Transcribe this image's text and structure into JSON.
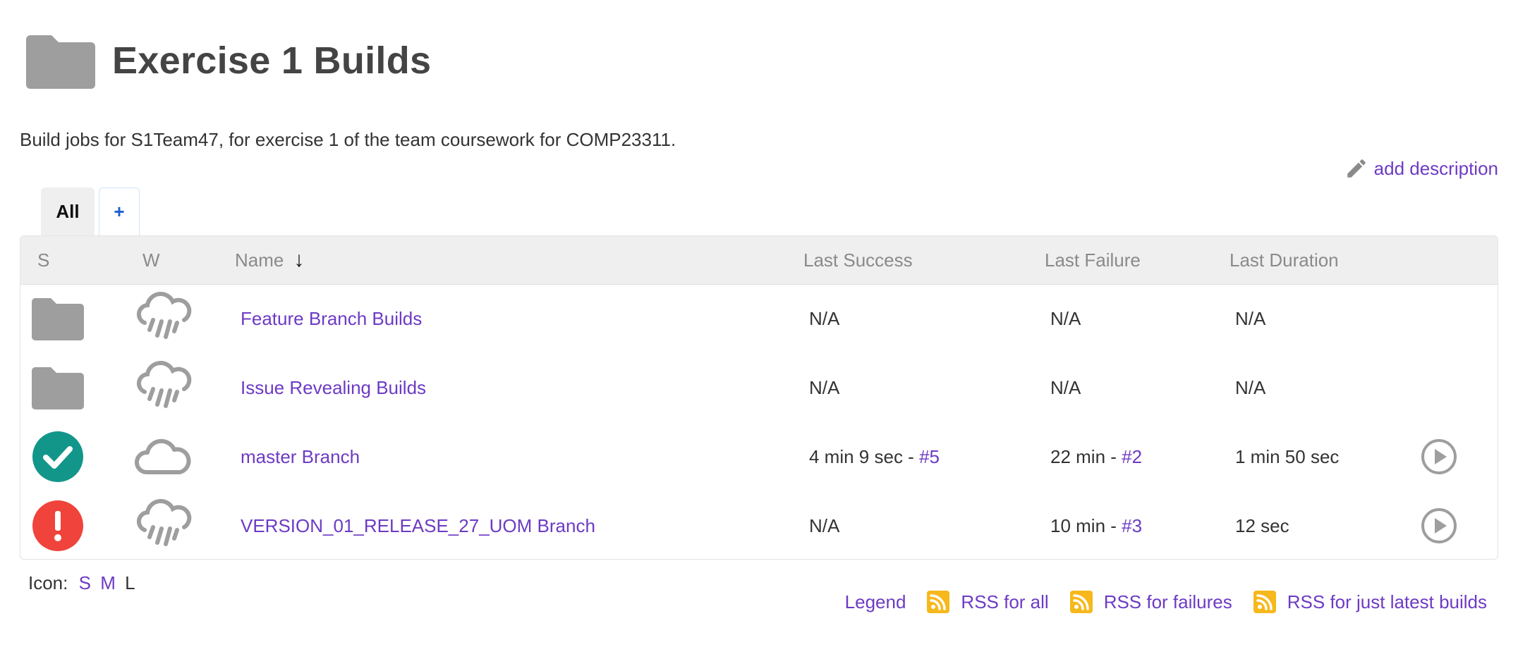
{
  "header": {
    "title": "Exercise 1 Builds"
  },
  "description": "Build jobs for S1Team47, for exercise 1 of the team coursework for COMP23311.",
  "add_description": "add description",
  "tabs": {
    "all": "All",
    "add": "+"
  },
  "table": {
    "headers": {
      "s": "S",
      "w": "W",
      "name": "Name",
      "sort_arrow": "↓",
      "last_success": "Last Success",
      "last_failure": "Last Failure",
      "last_duration": "Last Duration"
    },
    "rows": [
      {
        "status_icon": "folder-icon",
        "weather_icon": "rain-cloud-icon",
        "name": "Feature Branch Builds",
        "last_success": "N/A",
        "last_success_link": "",
        "last_failure": "N/A",
        "last_failure_link": "",
        "last_duration": "N/A",
        "action": ""
      },
      {
        "status_icon": "folder-icon",
        "weather_icon": "rain-cloud-icon",
        "name": "Issue Revealing Builds",
        "last_success": "N/A",
        "last_success_link": "",
        "last_failure": "N/A",
        "last_failure_link": "",
        "last_duration": "N/A",
        "action": ""
      },
      {
        "status_icon": "success-check-icon",
        "weather_icon": "cloud-icon",
        "name": "master Branch",
        "last_success": "4 min 9 sec - ",
        "last_success_link": "#5",
        "last_failure": "22 min - ",
        "last_failure_link": "#2",
        "last_duration": "1 min 50 sec",
        "action": "play-build-icon"
      },
      {
        "status_icon": "failure-exclamation-icon",
        "weather_icon": "rain-cloud-icon",
        "name": "VERSION_01_RELEASE_27_UOM Branch",
        "last_success": "N/A",
        "last_success_link": "",
        "last_failure": "10 min - ",
        "last_failure_link": "#3",
        "last_duration": "12 sec",
        "action": "play-build-icon"
      }
    ]
  },
  "icon_size": {
    "label": "Icon:",
    "s": "S",
    "m": "M",
    "l": "L"
  },
  "footer": {
    "legend": "Legend",
    "rss_all": "RSS for all",
    "rss_failures": "RSS for failures",
    "rss_latest": "RSS for just latest builds"
  },
  "colors": {
    "link": "#6d3bc4",
    "success": "#12968a",
    "failure": "#f0433b",
    "icon_grey": "#9e9e9e",
    "rss": "#f6b81c"
  }
}
